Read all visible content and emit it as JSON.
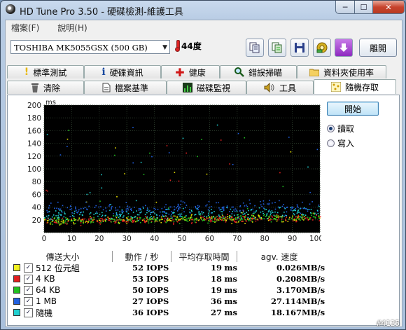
{
  "window": {
    "title": "HD Tune Pro 3.50 - 硬碟檢測-維護工具"
  },
  "menubar": [
    {
      "label": "檔案(F)"
    },
    {
      "label": "說明(H)"
    }
  ],
  "toolbar": {
    "drive": "TOSHIBA MK5055GSX (500 GB)",
    "temperature": "44度",
    "exit_label": "離開"
  },
  "tabs_top": [
    {
      "label": "標準測試",
      "icon": "exclamation-icon"
    },
    {
      "label": "硬碟資訊",
      "icon": "info-icon"
    },
    {
      "label": "健康",
      "icon": "health-cross-icon"
    },
    {
      "label": "錯誤掃瞄",
      "icon": "magnifier-icon"
    },
    {
      "label": "資料夾使用率",
      "icon": "folder-icon"
    }
  ],
  "tabs_bottom": [
    {
      "label": "清除",
      "icon": "trash-icon"
    },
    {
      "label": "檔案基準",
      "icon": "file-icon"
    },
    {
      "label": "磁碟監視",
      "icon": "monitor-chart-icon"
    },
    {
      "label": "工具",
      "icon": "speaker-icon"
    },
    {
      "label": "隨機存取",
      "icon": "random-access-icon",
      "active": true
    }
  ],
  "controls": {
    "start_label": "開始",
    "read_label": "讀取",
    "write_label": "寫入",
    "mode": "read"
  },
  "chart_data": {
    "type": "scatter",
    "ylabel": "ms",
    "y_ticks": [
      "200",
      "180",
      "160",
      "140",
      "120",
      "100",
      "80",
      "60",
      "40",
      "20"
    ],
    "x_ticks": [
      "0",
      "10",
      "20",
      "30",
      "40",
      "50",
      "60",
      "70",
      "80",
      "90",
      "100%"
    ],
    "xlim": [
      0,
      100
    ],
    "ylim": [
      0,
      200
    ],
    "series": [
      {
        "name": "512 位元組",
        "color": "#e8e000",
        "center_ms": 19
      },
      {
        "name": "4 KB",
        "color": "#e02020",
        "center_ms": 18
      },
      {
        "name": "64 KB",
        "color": "#20c020",
        "center_ms": 19
      },
      {
        "name": "1 MB",
        "color": "#2060e0",
        "center_ms": 36
      },
      {
        "name": "隨機",
        "color": "#20d0d0",
        "center_ms": 27
      }
    ]
  },
  "results": {
    "headers": [
      "傳送大小",
      "動作 / 秒",
      "平均存取時間",
      "agv. 速度"
    ],
    "rows": [
      {
        "size": "512 位元組",
        "color": "#f0f020",
        "iops": "52",
        "iops_unit": "IOPS",
        "time": "19",
        "time_unit": "ms",
        "speed": "0.026",
        "speed_unit": "MB/s"
      },
      {
        "size": "4 KB",
        "color": "#e02020",
        "iops": "53",
        "iops_unit": "IOPS",
        "time": "18",
        "time_unit": "ms",
        "speed": "0.208",
        "speed_unit": "MB/s"
      },
      {
        "size": "64 KB",
        "color": "#20c020",
        "iops": "50",
        "iops_unit": "IOPS",
        "time": "19",
        "time_unit": "ms",
        "speed": "3.170",
        "speed_unit": "MB/s"
      },
      {
        "size": "1 MB",
        "color": "#2060e0",
        "iops": "27",
        "iops_unit": "IOPS",
        "time": "36",
        "time_unit": "ms",
        "speed": "27.114",
        "speed_unit": "MB/s"
      },
      {
        "size": "隨機",
        "color": "#20d0d0",
        "iops": "36",
        "iops_unit": "IOPS",
        "time": "27",
        "time_unit": "ms",
        "speed": "18.167",
        "speed_unit": "MB/s"
      }
    ]
  },
  "watermark": "#4125"
}
